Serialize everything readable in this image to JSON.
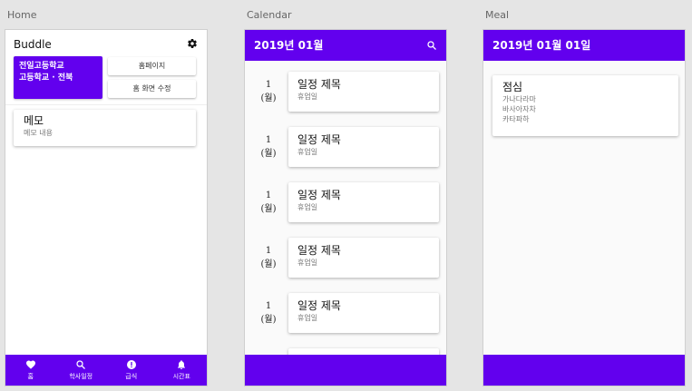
{
  "frames": {
    "home_label": "Home",
    "calendar_label": "Calendar",
    "meal_label": "Meal"
  },
  "home": {
    "title": "Buddle",
    "school_name": "전일고등학교",
    "school_info": "고등학교 · 전북",
    "homepage_button": "홈페이지",
    "edit_home_button": "홈 화면 수정",
    "memo_title": "메모",
    "memo_body": "메모 내용",
    "nav": [
      {
        "label": "홈",
        "icon": "heart-icon"
      },
      {
        "label": "학사일정",
        "icon": "search-icon"
      },
      {
        "label": "급식",
        "icon": "alert-icon"
      },
      {
        "label": "시간표",
        "icon": "bell-icon"
      }
    ]
  },
  "calendar": {
    "title": "2019년 01월",
    "events": [
      {
        "day": "1",
        "weekday": "(월)",
        "title": "일정 제목",
        "sub": "휴업일"
      },
      {
        "day": "1",
        "weekday": "(월)",
        "title": "일정 제목",
        "sub": "휴업일"
      },
      {
        "day": "1",
        "weekday": "(월)",
        "title": "일정 제목",
        "sub": "휴업일"
      },
      {
        "day": "1",
        "weekday": "(월)",
        "title": "일정 제목",
        "sub": "휴업일"
      },
      {
        "day": "1",
        "weekday": "(월)",
        "title": "일정 제목",
        "sub": "휴업일"
      }
    ]
  },
  "meal": {
    "title": "2019년 01월 01일",
    "meal_name": "점심",
    "items": [
      "가나다라마",
      "바사아자차",
      "카타파하"
    ]
  },
  "colors": {
    "accent": "#6200ee",
    "background": "#e5e5e5"
  }
}
